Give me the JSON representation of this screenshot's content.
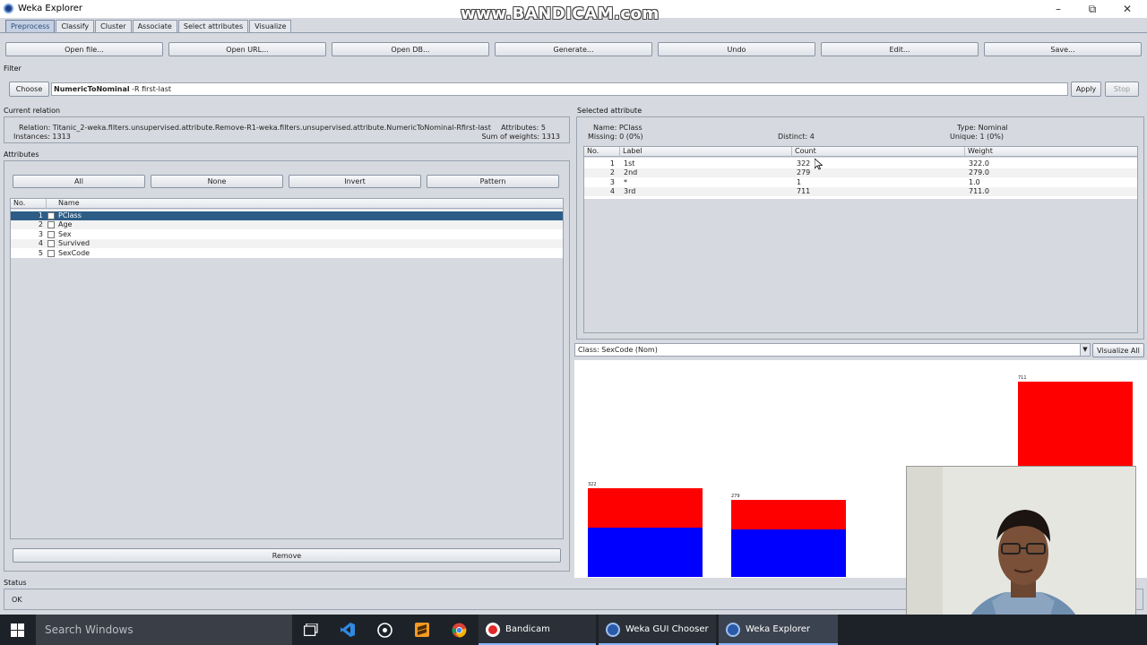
{
  "window": {
    "title": "Weka Explorer",
    "watermark": "www.BANDICAM.com"
  },
  "tabs": [
    "Preprocess",
    "Classify",
    "Cluster",
    "Associate",
    "Select attributes",
    "Visualize"
  ],
  "toolbar": {
    "open_file": "Open file...",
    "open_url": "Open URL...",
    "open_db": "Open DB...",
    "generate": "Generate...",
    "undo": "Undo",
    "edit": "Edit...",
    "save": "Save..."
  },
  "filter": {
    "label": "Filter",
    "choose": "Choose",
    "name": "NumericToNominal",
    "options": " -R first-last",
    "apply": "Apply",
    "stop": "Stop"
  },
  "relation": {
    "label": "Current relation",
    "relation_text": "Relation: Titanic_2-weka.filters.unsupervised.attribute.Remove-R1-weka.filters.unsupervised.attribute.NumericToNominal-Rfirst-last",
    "instances_text": "Instances: 1313",
    "attributes_text": "Attributes: 5",
    "weights_text": "Sum of weights: 1313"
  },
  "attributes": {
    "label": "Attributes",
    "all": "All",
    "none": "None",
    "invert": "Invert",
    "pattern": "Pattern",
    "col_no": "No.",
    "col_name": "Name",
    "rows": [
      {
        "no": "1",
        "name": "PClass"
      },
      {
        "no": "2",
        "name": "Age"
      },
      {
        "no": "3",
        "name": "Sex"
      },
      {
        "no": "4",
        "name": "Survived"
      },
      {
        "no": "5",
        "name": "SexCode"
      }
    ],
    "remove": "Remove"
  },
  "selected": {
    "label": "Selected attribute",
    "name_text": "Name: PClass",
    "missing_text": "Missing: 0 (0%)",
    "distinct_text": "Distinct: 4",
    "type_text": "Type: Nominal",
    "unique_text": "Unique: 1 (0%)",
    "col_no": "No.",
    "col_label": "Label",
    "col_count": "Count",
    "col_weight": "Weight",
    "rows": [
      {
        "no": "1",
        "label": "1st",
        "count": "322",
        "weight": "322.0"
      },
      {
        "no": "2",
        "label": "2nd",
        "count": "279",
        "weight": "279.0"
      },
      {
        "no": "3",
        "label": "*",
        "count": "1",
        "weight": "1.0"
      },
      {
        "no": "4",
        "label": "3rd",
        "count": "711",
        "weight": "711.0"
      }
    ]
  },
  "class_select": {
    "value": "Class: SexCode (Nom)",
    "visualize_all": "Visualize All"
  },
  "histogram": {
    "bars": [
      {
        "count": "322",
        "red_frac": 0.44
      },
      {
        "count": "279",
        "red_frac": 0.38
      },
      {
        "count": "1",
        "red_frac": 0
      },
      {
        "count": "711",
        "red_frac": 0.55
      }
    ],
    "colors": {
      "red": "#ff0000",
      "blue": "#0000ff"
    }
  },
  "status": {
    "label": "Status",
    "text": "OK"
  },
  "taskbar": {
    "search": "Search Windows",
    "apps": [
      "Bandicam (Unregist...",
      "Weka GUI Chooser",
      "Weka Explorer"
    ]
  }
}
